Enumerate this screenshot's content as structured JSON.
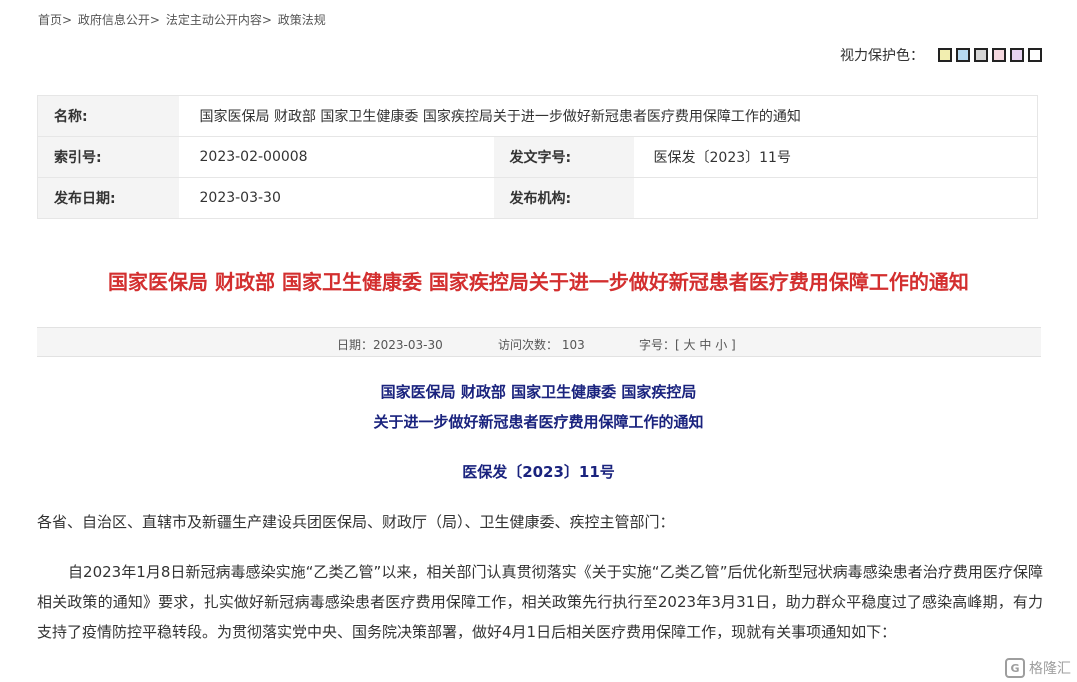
{
  "breadcrumb": {
    "items": [
      "首页",
      "政府信息公开",
      "法定主动公开内容",
      "政策法规"
    ],
    "separator": ">"
  },
  "eye_protection": {
    "label": "视力保护色：",
    "colors": [
      "#f2eeb0",
      "#b6d9f0",
      "#d6d6d6",
      "#f4d7de",
      "#e6d2f0",
      "#ffffff"
    ]
  },
  "meta": {
    "name_label": "名称:",
    "name_value": "国家医保局 财政部 国家卫生健康委 国家疾控局关于进一步做好新冠患者医疗费用保障工作的通知",
    "index_label": "索引号:",
    "index_value": "2023-02-00008",
    "docno_label": "发文字号:",
    "docno_value": "医保发〔2023〕11号",
    "date_label": "发布日期:",
    "date_value": "2023-03-30",
    "org_label": "发布机构:",
    "org_value": ""
  },
  "title": "国家医保局 财政部 国家卫生健康委 国家疾控局关于进一步做好新冠患者医疗费用保障工作的通知",
  "info_bar": {
    "date": "日期：2023-03-30",
    "visits": "访问次数：   103",
    "font_size_label": "字号：[",
    "size_large": "大",
    "size_medium": "中",
    "size_small": "小",
    "close": "]"
  },
  "document": {
    "issuer": "国家医保局 财政部 国家卫生健康委 国家疾控局",
    "subject": "关于进一步做好新冠患者医疗费用保障工作的通知",
    "doc_number": "医保发〔2023〕11号",
    "addressee": "各省、自治区、直辖市及新疆生产建设兵团医保局、财政厅（局）、卫生健康委、疾控主管部门：",
    "paragraph1": "自2023年1月8日新冠病毒感染实施“乙类乙管”以来，相关部门认真贯彻落实《关于实施“乙类乙管”后优化新型冠状病毒感染患者治疗费用医疗保障相关政策的通知》要求，扎实做好新冠病毒感染患者医疗费用保障工作，相关政策先行执行至2023年3月31日，助力群众平稳度过了感染高峰期，有力支持了疫情防控平稳转段。为贯彻落实党中央、国务院决策部署，做好4月1日后相关医疗费用保障工作，现就有关事项通知如下："
  },
  "watermark": "格隆汇"
}
